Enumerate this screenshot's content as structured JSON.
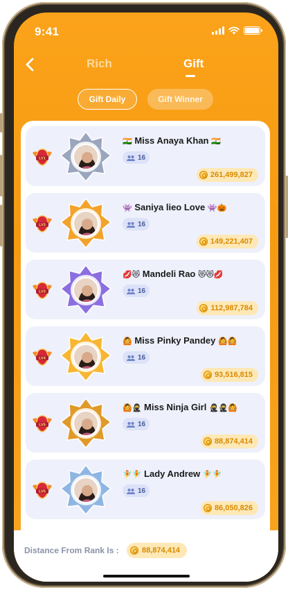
{
  "status_bar": {
    "time": "9:41",
    "signal_icon": "signal-icon",
    "wifi_icon": "wifi-icon",
    "battery_icon": "battery-icon"
  },
  "nav": {
    "back_icon": "chevron-left-icon",
    "tabs": [
      {
        "label": "Rich",
        "active": false
      },
      {
        "label": "Gift",
        "active": true
      }
    ]
  },
  "filters": [
    {
      "label": "Gift Daily",
      "active": true
    },
    {
      "label": "Gift Winner",
      "active": false
    }
  ],
  "ranking": [
    {
      "flag_left": "🇮🇳",
      "name": "Miss Anaya Khan",
      "flag_right": "🇮🇳",
      "level_badge": "LV1",
      "group_count": "16",
      "coins": "261,499,827",
      "frame_color": "#9aa6bd"
    },
    {
      "flag_left": "👾",
      "name": "Saniya lieo Love",
      "flag_right": "👾🎃",
      "level_badge": "LV3",
      "group_count": "16",
      "coins": "149,221,407",
      "frame_color": "#f3a32c"
    },
    {
      "flag_left": "💋😻",
      "name": "Mandeli Rao",
      "flag_right": "😻😻💋",
      "level_badge": "LV3",
      "group_count": "16",
      "coins": "112,987,784",
      "frame_color": "#8b6fe0"
    },
    {
      "flag_left": "🙆",
      "name": "Miss Pinky Pandey",
      "flag_right": "🙆🙆",
      "level_badge": "LV4",
      "group_count": "16",
      "coins": "93,516,815",
      "frame_color": "#f7b733"
    },
    {
      "flag_left": "🙆🥷",
      "name": "Miss Ninja Girl",
      "flag_right": "🥷🥷🙆",
      "level_badge": "LV5",
      "group_count": "16",
      "coins": "88,874,414",
      "frame_color": "#e09a2a"
    },
    {
      "flag_left": "🧚🧚",
      "name": "Lady Andrew",
      "flag_right": "🧚🧚",
      "level_badge": "LV5",
      "group_count": "16",
      "coins": "86,050,826",
      "frame_color": "#8fb6e3"
    }
  ],
  "footer": {
    "label": "Distance From Rank Is :",
    "value": "88,874,414"
  },
  "colors": {
    "accent": "#f69a12",
    "card_bg": "#eef0fb",
    "coin_bg": "#fde8b6",
    "coin_text": "#d98a00"
  }
}
